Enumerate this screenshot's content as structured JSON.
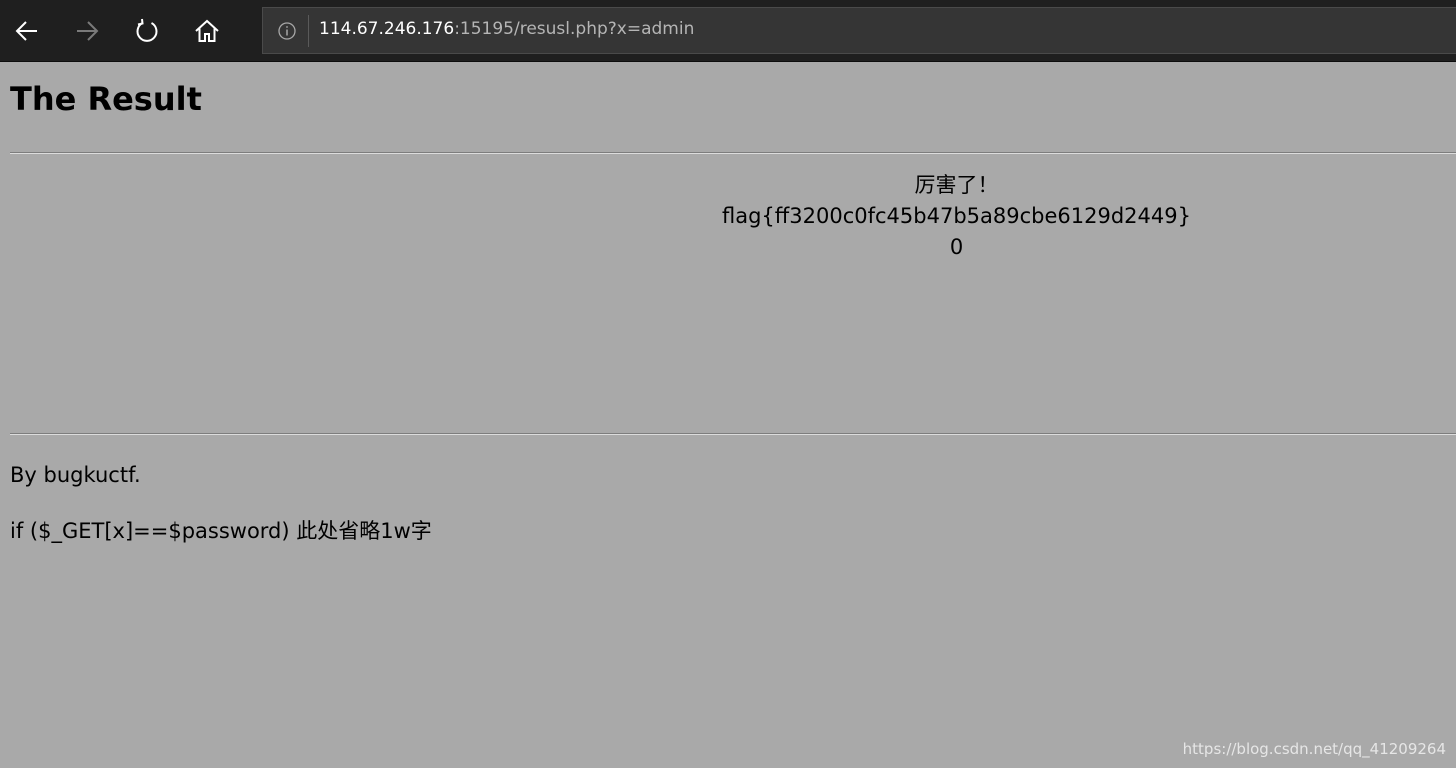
{
  "browser": {
    "url_host": "114.67.246.176",
    "url_rest": ":15195/resusl.php?x=admin"
  },
  "page": {
    "title": "The Result",
    "result_lines": [
      "厉害了！",
      "flag{ff3200c0fc45b47b5a89cbe6129d2449}",
      "0"
    ],
    "by_line": "By bugkuctf.",
    "code_line": "if ($_GET[x]==$password) 此处省略1w字"
  },
  "watermark": "https://blog.csdn.net/qq_41209264",
  "colors": {
    "toolbar_bg": "#1f1f1f",
    "address_bg": "#353535",
    "page_bg": "#a9a9a9"
  }
}
